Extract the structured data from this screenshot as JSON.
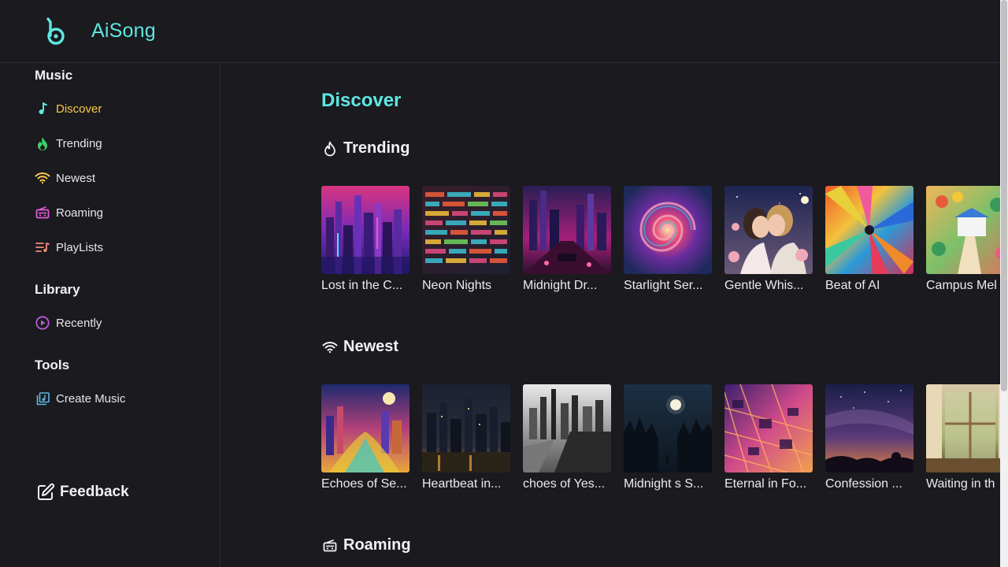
{
  "app": {
    "name": "AiSong",
    "accent": "#5ee8e0",
    "active_color": "#f7c948"
  },
  "sidebar": {
    "music_title": "Music",
    "library_title": "Library",
    "tools_title": "Tools",
    "music_items": [
      {
        "label": "Discover",
        "icon": "music-note-icon"
      },
      {
        "label": "Trending",
        "icon": "flame-icon"
      },
      {
        "label": "Newest",
        "icon": "wifi-icon"
      },
      {
        "label": "Roaming",
        "icon": "radio-icon"
      },
      {
        "label": "PlayLists",
        "icon": "playlist-icon"
      }
    ],
    "library_items": [
      {
        "label": "Recently",
        "icon": "play-circle-icon"
      }
    ],
    "tools_items": [
      {
        "label": "Create Music",
        "icon": "music-library-icon"
      }
    ],
    "feedback_label": "Feedback"
  },
  "main": {
    "title": "Discover",
    "trending": {
      "title": "Trending",
      "items": [
        {
          "title": "Lost in the C..."
        },
        {
          "title": "Neon Nights"
        },
        {
          "title": "Midnight Dr..."
        },
        {
          "title": "Starlight Ser..."
        },
        {
          "title": "Gentle Whis..."
        },
        {
          "title": "Beat of AI"
        },
        {
          "title": "Campus Mel"
        }
      ]
    },
    "newest": {
      "title": "Newest",
      "items": [
        {
          "title": "Echoes of Se..."
        },
        {
          "title": "Heartbeat in..."
        },
        {
          "title": "choes of Yes..."
        },
        {
          "title": "Midnight s S..."
        },
        {
          "title": "Eternal in Fo..."
        },
        {
          "title": "Confession ..."
        },
        {
          "title": "Waiting in th"
        }
      ]
    },
    "roaming": {
      "title": "Roaming"
    }
  }
}
